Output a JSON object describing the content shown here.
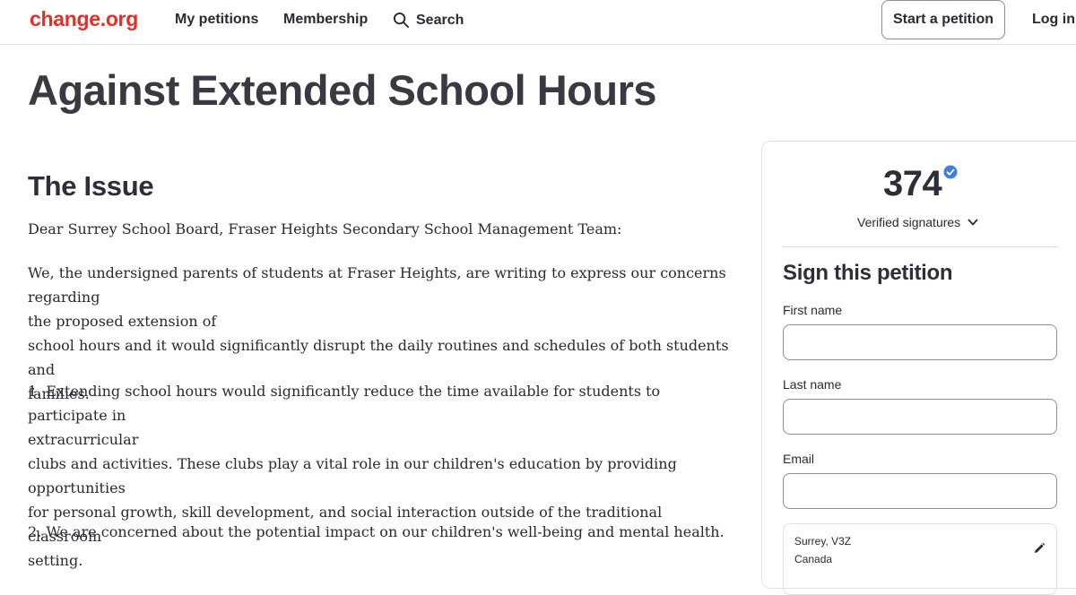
{
  "header": {
    "logo": "change.org",
    "nav": {
      "my_petitions": "My petitions",
      "membership": "Membership",
      "search": "Search"
    },
    "start_petition": "Start a petition",
    "login": "Log in"
  },
  "petition": {
    "title": "Against Extended School Hours",
    "issue_heading": "The Issue",
    "salutation": "Dear Surrey School Board, Fraser Heights Secondary School Management Team:",
    "paragraphs": [
      {
        "lines": [
          "We, the undersigned parents of students at Fraser Heights, are writing to express our concerns regarding",
          "the proposed extension of",
          "school hours and it would significantly disrupt the daily routines and schedules of both students and",
          "families."
        ]
      },
      {
        "lines": [
          "1. Extending school hours would significantly reduce the time available for students to participate in",
          "extracurricular",
          "clubs and activities. These clubs play a vital role in our children's education by providing opportunities",
          "for personal growth, skill development, and social interaction outside of the traditional classroom",
          "setting."
        ]
      },
      {
        "lines": [
          "2. We are concerned about the potential impact on our children's well-being and mental health."
        ]
      }
    ]
  },
  "sidebar": {
    "signature_count": "374",
    "verified_label": "Verified signatures",
    "sign_heading": "Sign this petition",
    "fields": {
      "first_name_label": "First name",
      "first_name_value": "",
      "last_name_label": "Last name",
      "last_name_value": "",
      "email_label": "Email",
      "email_value": ""
    },
    "location": {
      "line1": "Surrey, V3Z",
      "line2": "Canada"
    }
  },
  "colors": {
    "brand": "#ec2c22",
    "verified": "#3d7fe0",
    "text": "#2b2a33"
  }
}
